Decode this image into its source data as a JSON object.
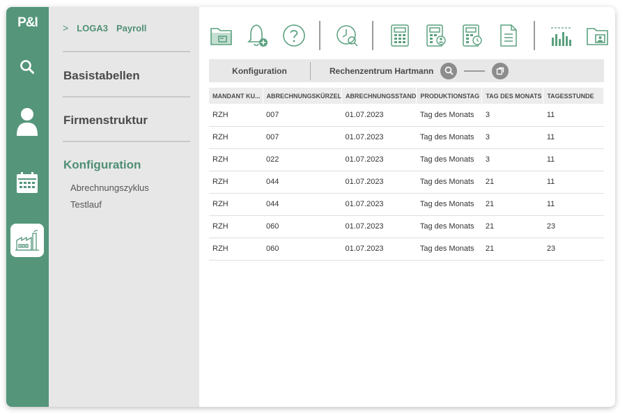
{
  "app": {
    "logo": "P&I"
  },
  "rail": {
    "items": [
      {
        "name": "search",
        "icon": "search-icon"
      },
      {
        "name": "user",
        "icon": "user-icon"
      },
      {
        "name": "calendar",
        "icon": "calendar-icon"
      },
      {
        "name": "factory",
        "icon": "factory-icon",
        "active": true
      }
    ]
  },
  "breadcrumb": {
    "chevron": ">",
    "app": "LOGA3",
    "module": "Payroll"
  },
  "nav": {
    "sections": [
      {
        "label": "Basistabellen"
      },
      {
        "label": "Firmenstruktur"
      },
      {
        "label": "Konfiguration",
        "active": true,
        "subitems": [
          "Abrechnungszyklus",
          "Testlauf"
        ]
      }
    ]
  },
  "toolbar": {
    "icons": [
      "folder-card-icon",
      "bell-add-icon",
      "help-icon",
      "clock-search-icon",
      "calculator-icon",
      "calculator-user-icon",
      "calculator-clock-icon",
      "document-icon",
      "bar-chart-icon",
      "folder-user-icon"
    ]
  },
  "filter": {
    "tab1": "Konfiguration",
    "tab2": "Rechenzentrum Hartmann"
  },
  "table": {
    "headers": [
      "MANDANT KU...",
      "ABRECHNUNGSKÜRZEL",
      "ABRECHNUNGSSTAND",
      "PRODUKTIONSTAG",
      "TAG DES MONATS",
      "TAGESSTUNDE"
    ],
    "rows": [
      [
        "RZH",
        "007",
        "01.07.2023",
        "Tag des Monats",
        "3",
        "11"
      ],
      [
        "RZH",
        "007",
        "01.07.2023",
        "Tag des Monats",
        "3",
        "11"
      ],
      [
        "RZH",
        "022",
        "01.07.2023",
        "Tag des Monats",
        "3",
        "11"
      ],
      [
        "RZH",
        "044",
        "01.07.2023",
        "Tag des Monats",
        "21",
        "11"
      ],
      [
        "RZH",
        "044",
        "01.07.2023",
        "Tag des Monats",
        "21",
        "11"
      ],
      [
        "RZH",
        "060",
        "01.07.2023",
        "Tag des Monats",
        "21",
        "23"
      ],
      [
        "RZH",
        "060",
        "01.07.2023",
        "Tag des Monats",
        "21",
        "23"
      ]
    ]
  },
  "colors": {
    "brand": "#55967b",
    "accent_text": "#4f8f74",
    "nav_bg": "#e7e7e7",
    "icon_green": "#5aa07e"
  }
}
